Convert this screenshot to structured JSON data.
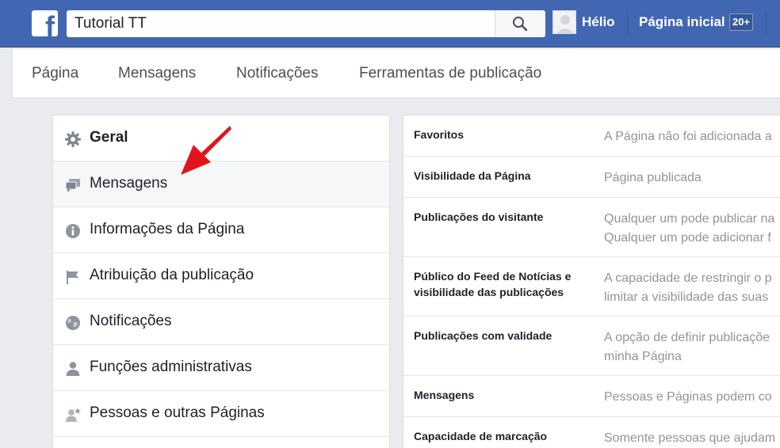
{
  "topbar": {
    "logo": "f",
    "search_value": "Tutorial TT",
    "user_name": "Hélio",
    "home_label": "Página inicial",
    "home_badge": "20+"
  },
  "page_tabs": [
    "Página",
    "Mensagens",
    "Notificações",
    "Ferramentas de publicação"
  ],
  "menu": [
    {
      "label": "Geral",
      "icon": "gear-icon"
    },
    {
      "label": "Mensagens",
      "icon": "messages-icon"
    },
    {
      "label": "Informações da Página",
      "icon": "info-icon"
    },
    {
      "label": "Atribuição da publicação",
      "icon": "flag-icon"
    },
    {
      "label": "Notificações",
      "icon": "globe-icon"
    },
    {
      "label": "Funções administrativas",
      "icon": "person-icon"
    },
    {
      "label": "Pessoas e outras Páginas",
      "icon": "person-star-icon"
    }
  ],
  "settings": [
    {
      "key": "Favoritos",
      "value": [
        "A Página não foi adicionada a"
      ]
    },
    {
      "key": "Visibilidade da Página",
      "value": [
        "Página publicada"
      ]
    },
    {
      "key": "Publicações do visitante",
      "value": [
        "Qualquer um pode publicar na",
        "Qualquer um pode adicionar f"
      ]
    },
    {
      "key": "Público do Feed de Notícias e visibilidade das publicações",
      "value": [
        "A capacidade de restringir o p",
        "limitar a visibilidade das suas"
      ]
    },
    {
      "key": "Publicações com validade",
      "value": [
        "A opção de definir publicaçõe",
        "minha Página"
      ]
    },
    {
      "key": "Mensagens",
      "value": [
        "Pessoas e Páginas podem co"
      ]
    },
    {
      "key": "Capacidade de marcação",
      "value": [
        "Somente pessoas que ajudam"
      ]
    }
  ],
  "colors": {
    "brand": "#4267b2",
    "annotation_arrow": "#e0141a"
  }
}
